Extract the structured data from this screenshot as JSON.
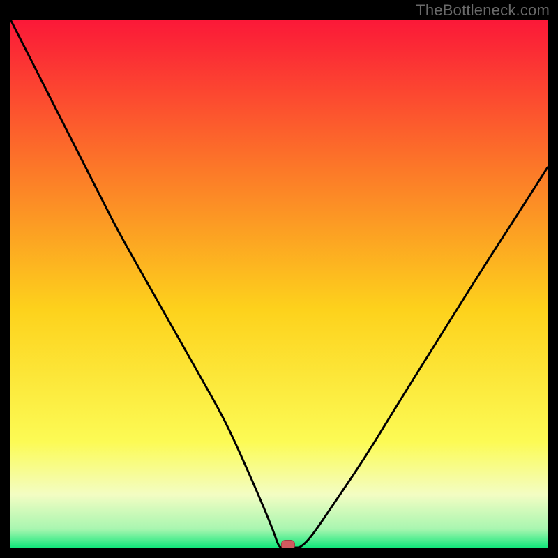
{
  "watermark": "TheBottleneck.com",
  "colors": {
    "background": "#000000",
    "gradient_top": "#fb1838",
    "gradient_mid_upper": "#fc6d2a",
    "gradient_mid": "#fdd21c",
    "gradient_mid_lower": "#fcfb55",
    "gradient_lower": "#f3fdc3",
    "gradient_bottom": "#13e77b",
    "curve": "#000000",
    "watermark": "#6a6a6a",
    "marker_fill": "#d05a5f",
    "marker_stroke": "#9e3f44"
  },
  "chart_data": {
    "type": "line",
    "title": "",
    "xlabel": "",
    "ylabel": "",
    "x": [
      0.0,
      0.02,
      0.05,
      0.08,
      0.12,
      0.16,
      0.2,
      0.25,
      0.3,
      0.35,
      0.4,
      0.44,
      0.47,
      0.49,
      0.5,
      0.51,
      0.52,
      0.53,
      0.54,
      0.56,
      0.6,
      0.66,
      0.72,
      0.8,
      0.88,
      0.95,
      1.0
    ],
    "values": [
      1.0,
      0.96,
      0.9,
      0.84,
      0.76,
      0.68,
      0.6,
      0.51,
      0.42,
      0.33,
      0.24,
      0.15,
      0.08,
      0.03,
      0.0,
      0.0,
      0.0,
      0.0,
      0.0,
      0.02,
      0.08,
      0.17,
      0.27,
      0.4,
      0.53,
      0.64,
      0.72
    ],
    "xlim": [
      0,
      1
    ],
    "ylim": [
      0,
      1
    ],
    "grid": false,
    "marker": {
      "x": 0.517,
      "y": 0.0,
      "shape": "rounded-rect"
    },
    "gradient_stops": [
      {
        "offset": 0.0,
        "color": "#fb1838"
      },
      {
        "offset": 0.25,
        "color": "#fc6d2a"
      },
      {
        "offset": 0.55,
        "color": "#fdd21c"
      },
      {
        "offset": 0.8,
        "color": "#fcfb55"
      },
      {
        "offset": 0.9,
        "color": "#f3fdc3"
      },
      {
        "offset": 0.965,
        "color": "#a8f6b0"
      },
      {
        "offset": 1.0,
        "color": "#13e77b"
      }
    ]
  }
}
